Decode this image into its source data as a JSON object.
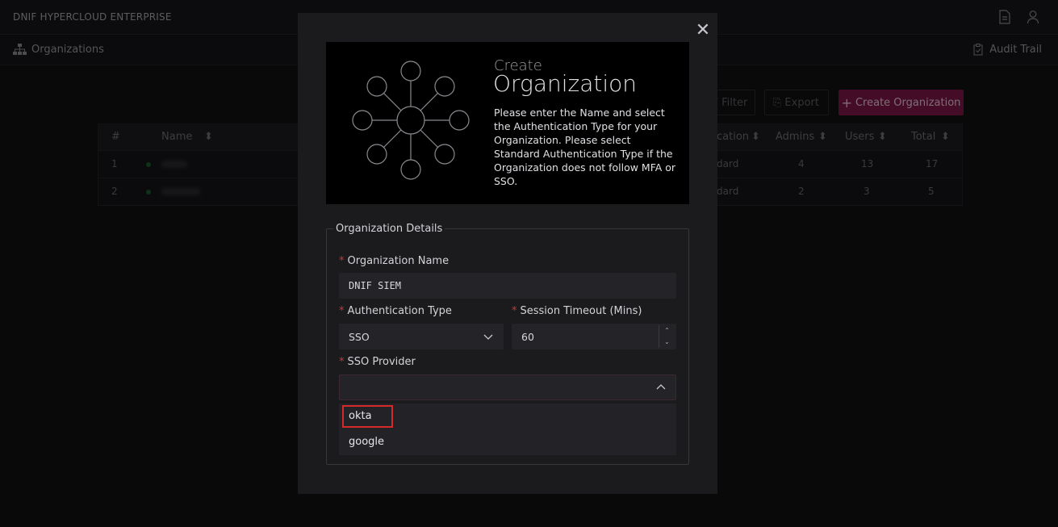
{
  "app": {
    "title": "DNIF HYPERCLOUD ENTERPRISE"
  },
  "subnav": {
    "breadcrumb": "Organizations",
    "audit_trail": "Audit Trail"
  },
  "toolbar": {
    "filter": "Filter",
    "export": "Export",
    "create": "Create Organization"
  },
  "table": {
    "columns": [
      "#",
      "Name",
      "cation",
      "Admins",
      "Users",
      "Total"
    ],
    "rows": [
      {
        "index": "1",
        "auth": "dard",
        "admins": "4",
        "users": "13",
        "total": "17"
      },
      {
        "index": "2",
        "auth": "dard",
        "admins": "2",
        "users": "3",
        "total": "5"
      }
    ]
  },
  "modal": {
    "pre_title": "Create",
    "title": "Organization",
    "description": "Please enter the Name and select the Authentication Type for your Organization. Please select Standard Authentication Type if the Organization does not follow MFA or SSO.",
    "section": "Organization Details",
    "org_name_label": "Organization Name",
    "org_name_value": "DNIF SIEM",
    "auth_type_label": "Authentication Type",
    "auth_type_value": "SSO",
    "session_timeout_label": "Session Timeout (Mins)",
    "session_timeout_value": "60",
    "sso_provider_label": "SSO Provider",
    "sso_provider_value": "",
    "sso_options": [
      "okta",
      "google"
    ]
  },
  "colors": {
    "accent": "#7d1747",
    "required": "#c43a3a",
    "highlight": "#d62a2a"
  }
}
